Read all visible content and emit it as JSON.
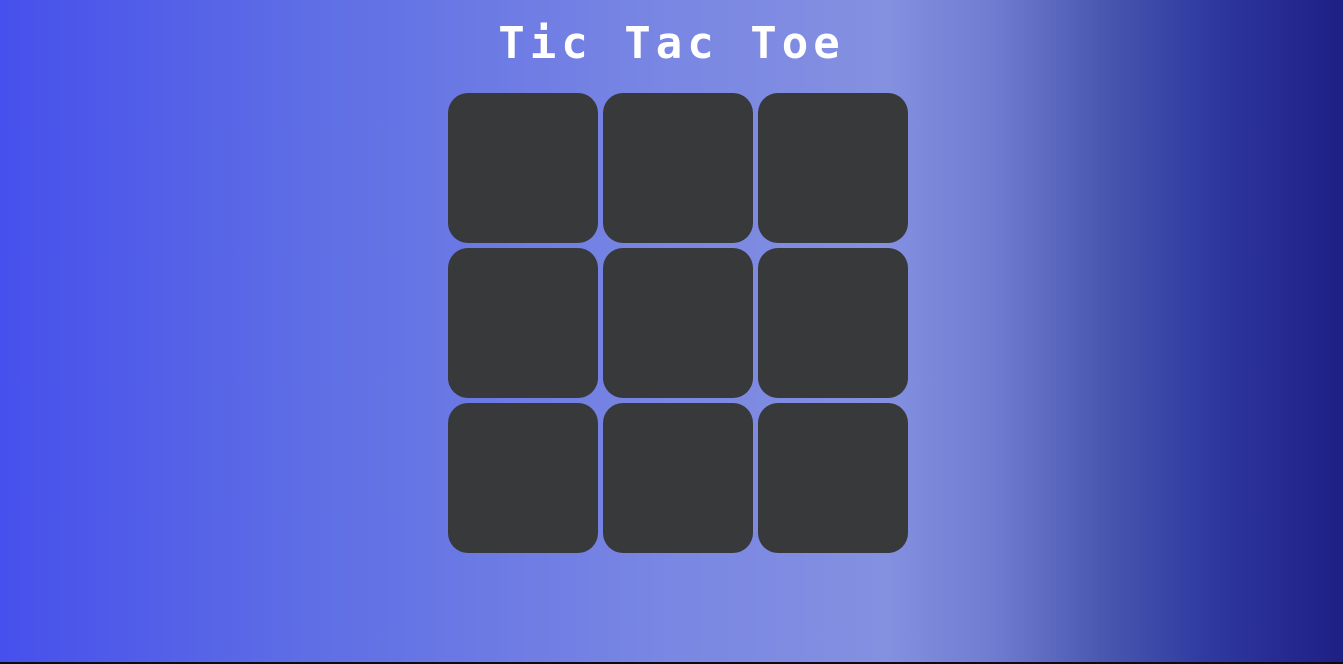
{
  "game": {
    "title": "Tic Tac Toe",
    "cells": [
      "",
      "",
      "",
      "",
      "",
      "",
      "",
      "",
      ""
    ]
  },
  "colors": {
    "cell_background": "#38393b",
    "title_text": "#ffffff",
    "gradient_left": "#4650ec",
    "gradient_mid": "#8490e0",
    "gradient_right": "#1e1f85"
  }
}
